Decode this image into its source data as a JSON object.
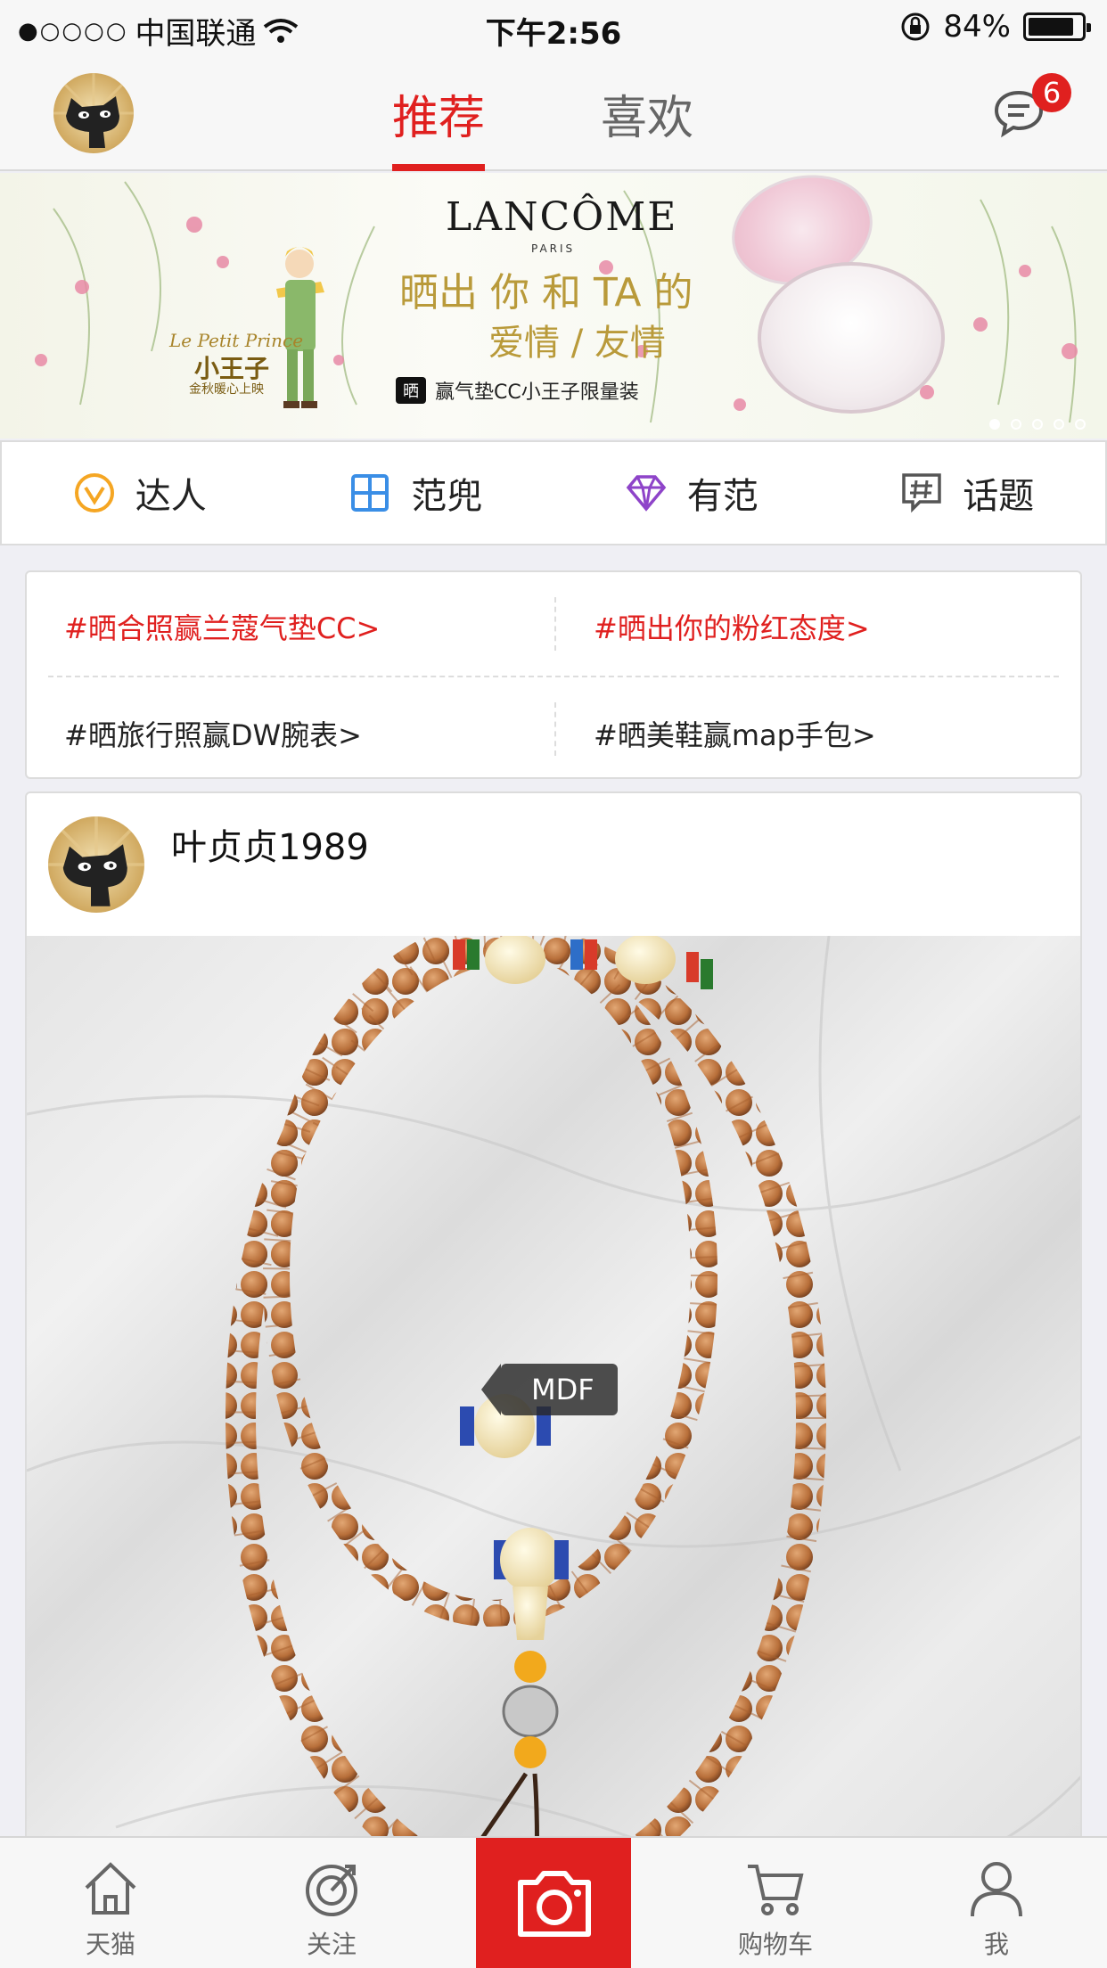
{
  "status_bar": {
    "signal_dots": "●○○○○",
    "carrier": "中国联通",
    "time": "下午2:56",
    "battery_percent": "84%",
    "battery_level": 0.84
  },
  "header": {
    "tabs": [
      {
        "label": "推荐",
        "active": true
      },
      {
        "label": "喜欢",
        "active": false
      }
    ],
    "message_badge": "6"
  },
  "banner": {
    "brand": "LANCÔME",
    "brand_sub": "PARIS",
    "headline_1": "晒出 你 和 TA 的",
    "headline_2": "爱情 / 友情",
    "promo_tag": "晒",
    "promo_text": "赢气垫CC小王子限量装",
    "movie_title_en": "Le Petit Prince",
    "movie_title_cn": "小王子",
    "movie_sub": "金秋暖心上映",
    "pager_count": 5,
    "pager_active": 0
  },
  "categories": [
    {
      "label": "达人",
      "icon": "v-badge-icon",
      "color": "#f5a623"
    },
    {
      "label": "范兜",
      "icon": "grid-icon",
      "color": "#3a8ee6"
    },
    {
      "label": "有范",
      "icon": "diamond-icon",
      "color": "#8e44c9"
    },
    {
      "label": "话题",
      "icon": "hashtag-chat-icon",
      "color": "#555555"
    }
  ],
  "topics": [
    {
      "text": "#晒合照赢兰蔻气垫CC>",
      "highlight": true
    },
    {
      "text": "#晒出你的粉红态度>",
      "highlight": true
    },
    {
      "text": "#晒旅行照赢DW腕表>",
      "highlight": false
    },
    {
      "text": "#晒美鞋赢map手包>",
      "highlight": false
    }
  ],
  "post": {
    "username": "叶贞贞1989",
    "photo_tag": "MDF"
  },
  "tabbar": {
    "items": [
      {
        "label": "天猫",
        "icon": "home-icon"
      },
      {
        "label": "关注",
        "icon": "target-icon"
      },
      {
        "label": "",
        "icon": "camera-icon"
      },
      {
        "label": "购物车",
        "icon": "cart-icon"
      },
      {
        "label": "我",
        "icon": "user-icon"
      }
    ]
  },
  "colors": {
    "accent": "#e0201f",
    "background": "#efeff4"
  }
}
